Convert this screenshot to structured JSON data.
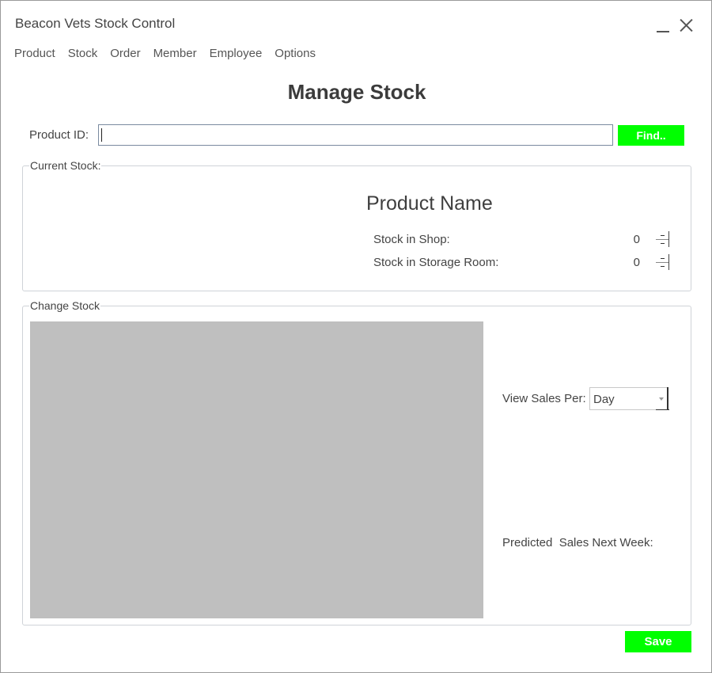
{
  "window": {
    "title": "Beacon Vets Stock Control"
  },
  "menu": [
    "Product",
    "Stock",
    "Order",
    "Member",
    "Employee",
    "Options"
  ],
  "page": {
    "heading": "Manage Stock"
  },
  "search": {
    "label": "Product ID:",
    "value": "",
    "find_label": "Find.."
  },
  "current_stock": {
    "group_title": "Current Stock:",
    "product_name": "Product Name",
    "shop_label": "Stock in Shop:",
    "shop_value": "0",
    "storage_label": "Stock in Storage Room:",
    "storage_value": "0"
  },
  "change_stock": {
    "group_title": "Change Stock",
    "view_sales_label": "View Sales Per:",
    "view_sales_value": "Day",
    "predicted_label": "Predicted  Sales Next Week:"
  },
  "actions": {
    "save_label": "Save"
  },
  "colors": {
    "accent": "#00ff00",
    "placeholder_chart": "#bfbfbf"
  }
}
